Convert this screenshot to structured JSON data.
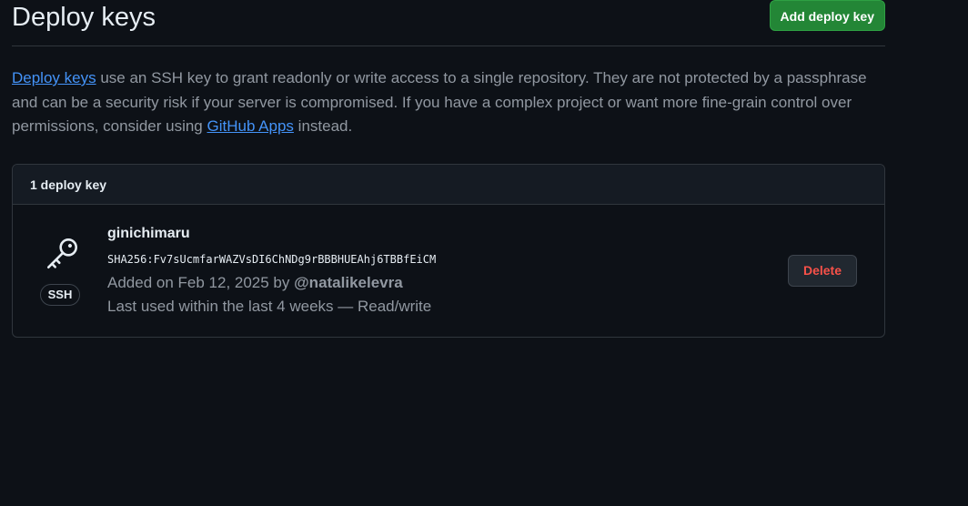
{
  "header": {
    "title": "Deploy keys",
    "add_button_label": "Add deploy key"
  },
  "description": {
    "link_deploy_keys": "Deploy keys",
    "text_1": " use an SSH key to grant readonly or write access to a single repository. They are not protected by a passphrase and can be a security risk if your server is compromised. If you have a complex project or want more fine-grain control over permissions, consider using ",
    "link_github_apps": "GitHub Apps",
    "text_2": " instead."
  },
  "panel": {
    "header_label": "1 deploy key",
    "keys": [
      {
        "icon": "key-icon",
        "type_badge": "SSH",
        "name": "ginichimaru",
        "fingerprint": "SHA256:Fv7sUcmfarWAZVsDI6ChNDg9rBBBHUEAhj6TBBfEiCM",
        "added_prefix": "Added on Feb 12, 2025 by ",
        "added_by": "@natalikelevra",
        "last_used": "Last used within the last 4 weeks — Read/write",
        "delete_label": "Delete"
      }
    ]
  },
  "colors": {
    "background": "#0d1117",
    "primary_button": "#238636",
    "link": "#4493f8",
    "danger": "#f85149",
    "muted_text": "#9198a1"
  }
}
